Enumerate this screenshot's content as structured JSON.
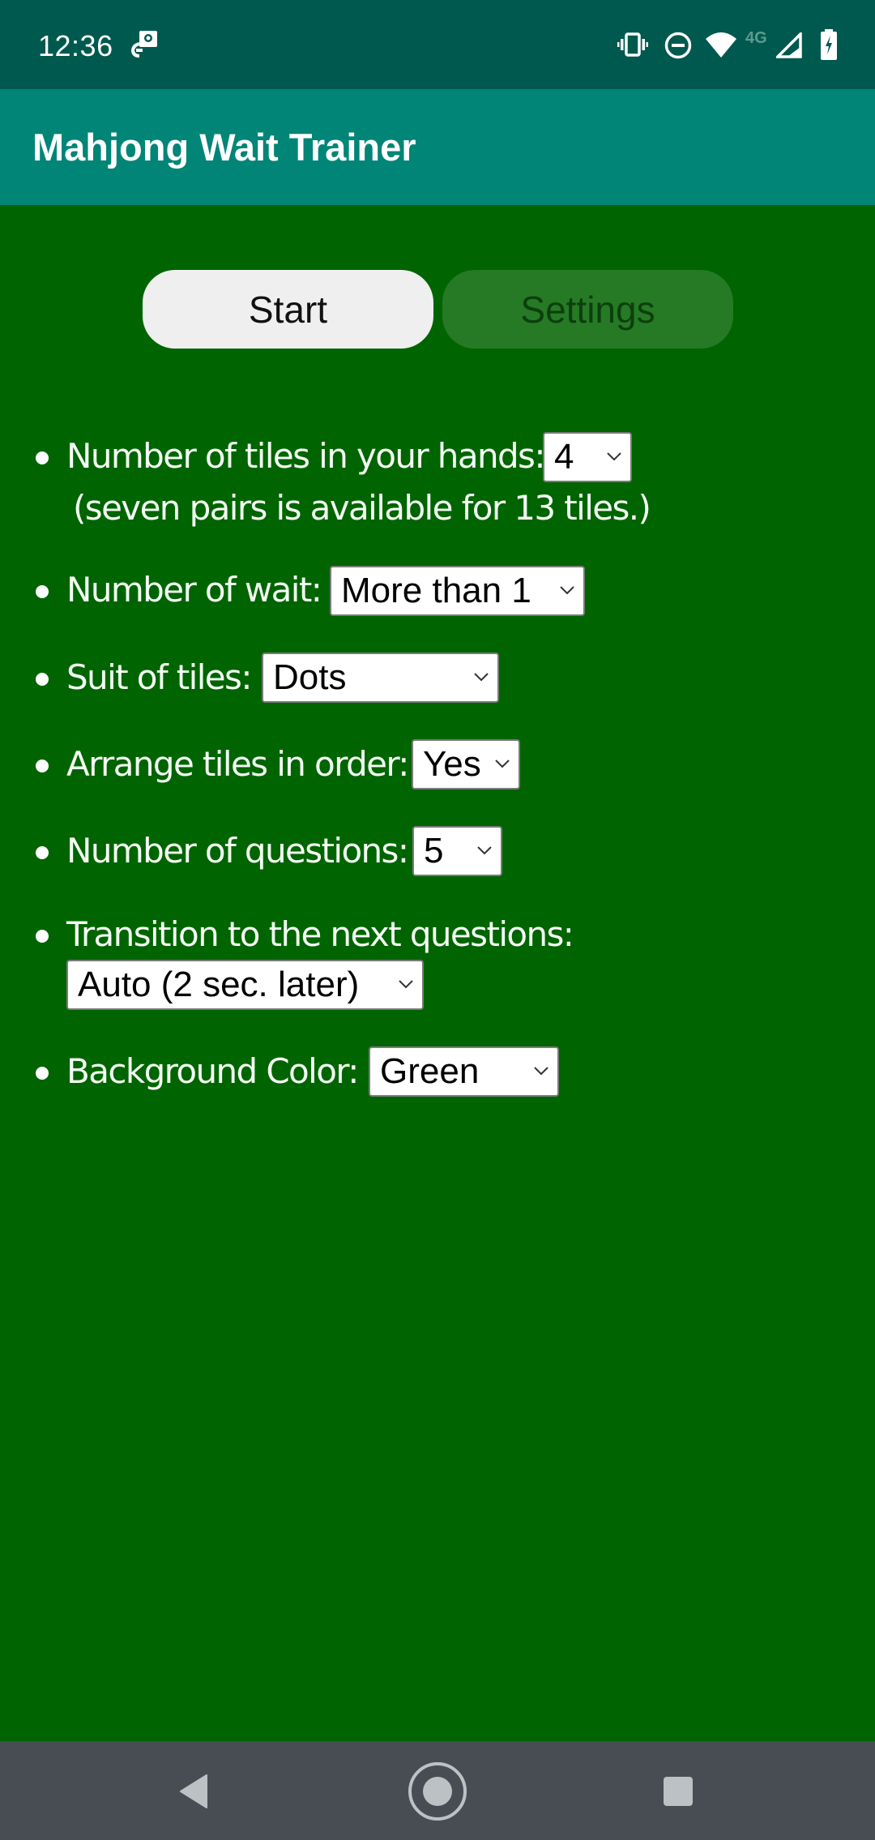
{
  "status_bar": {
    "time": "12:36",
    "notification_icons": [
      "vpn-key-icon"
    ],
    "system_icons": [
      "vibrate-icon",
      "do-not-disturb-icon",
      "wifi-icon",
      "4g-icon",
      "cell-signal-icon",
      "battery-charging-icon"
    ],
    "network_label": "4G"
  },
  "app_bar": {
    "title": "Mahjong Wait Trainer"
  },
  "tabs": [
    {
      "label": "Start",
      "active": true
    },
    {
      "label": "Settings",
      "active": false
    }
  ],
  "settings": [
    {
      "label": "Number of tiles in your hands:",
      "value": "4",
      "note": "(seven pairs is available for 13 tiles.)"
    },
    {
      "label": "Number of wait:",
      "value": "More than 1"
    },
    {
      "label": "Suit of tiles:",
      "value": "Dots"
    },
    {
      "label": "Arrange tiles in order:",
      "value": "Yes"
    },
    {
      "label": "Number of questions:",
      "value": "5"
    },
    {
      "label": "Transition to the next questions:",
      "value": "Auto (2 sec. later)"
    },
    {
      "label": "Background Color:",
      "value": "Green"
    }
  ],
  "nav_bar": {
    "buttons": [
      "back",
      "home",
      "recents"
    ]
  },
  "colors": {
    "status_bar": "#00594E",
    "app_bar": "#008577",
    "background": "#006400",
    "start_button": "#EFEFEF",
    "settings_button": "#267A26",
    "nav_bar": "#474D53"
  }
}
